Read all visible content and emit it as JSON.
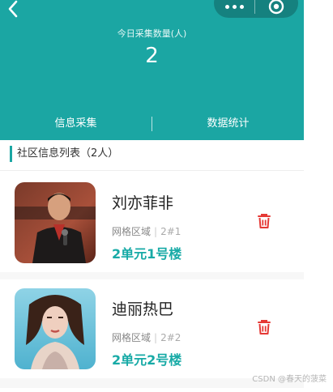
{
  "header": {
    "count_label": "今日采集数量(人)",
    "count_value": "2",
    "tabs": [
      {
        "label": "信息采集"
      },
      {
        "label": "数据统计"
      }
    ]
  },
  "list": {
    "title": "社区信息列表（2人）",
    "items": [
      {
        "name": "刘亦菲非",
        "region_label": "网格区域",
        "region_code": "2#1",
        "address": "2单元1号楼"
      },
      {
        "name": "迪丽热巴",
        "region_label": "网格区域",
        "region_code": "2#2",
        "address": "2单元2号楼"
      }
    ]
  },
  "icons": {
    "back": "chevron-left-icon",
    "more": "more-dots-icon",
    "close": "target-circle-icon",
    "delete": "trash-icon"
  },
  "colors": {
    "primary": "#1ba6a3",
    "address": "#17aaa6",
    "delete": "#e53935"
  },
  "watermark": "CSDN @春天的菠菜"
}
